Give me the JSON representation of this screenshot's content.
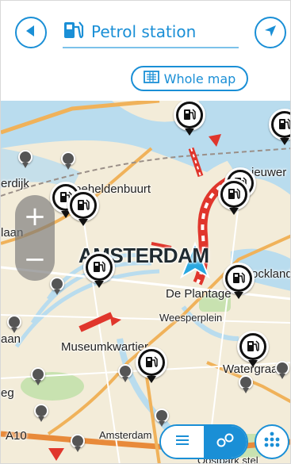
{
  "header": {
    "title": "Petrol station",
    "back_icon": "back-arrow-icon",
    "location_icon": "navigation-arrow-icon",
    "title_icon": "petrol-pump-icon",
    "scope_button": {
      "label": "Whole map",
      "icon": "map-icon"
    }
  },
  "map": {
    "labels": {
      "amsterdam": "AMSTERDAM",
      "zeeheldenbuurt": "Zeeheldenbuurt",
      "erdijk": "erdijk",
      "laan": "laan",
      "aan": "aan",
      "de_plantage": "De Plantage",
      "weesperplein": "Weesperplein",
      "museumkwartier": "Museumkwartier",
      "watergraaf": "Watergraaf",
      "eg": "eg",
      "a10": "A10",
      "amsterdam_bottom": "Amsterdam",
      "oostelijk": "ockland",
      "ieuwer": "ieuwer",
      "oostparkstel": "Oostpark stel"
    },
    "zoom": {
      "in": "+",
      "out": "−"
    }
  },
  "controls": {
    "list_view_icon": "list-icon",
    "map_view_icon": "pins-icon",
    "main_menu_icon": "menu-dots-icon"
  },
  "colors": {
    "accent": "#1a8fd6",
    "poi": "#111111",
    "route": "#e0362c",
    "current_location": "#29a8e0",
    "water": "#b9dcee",
    "land": "#f3ecd9"
  }
}
